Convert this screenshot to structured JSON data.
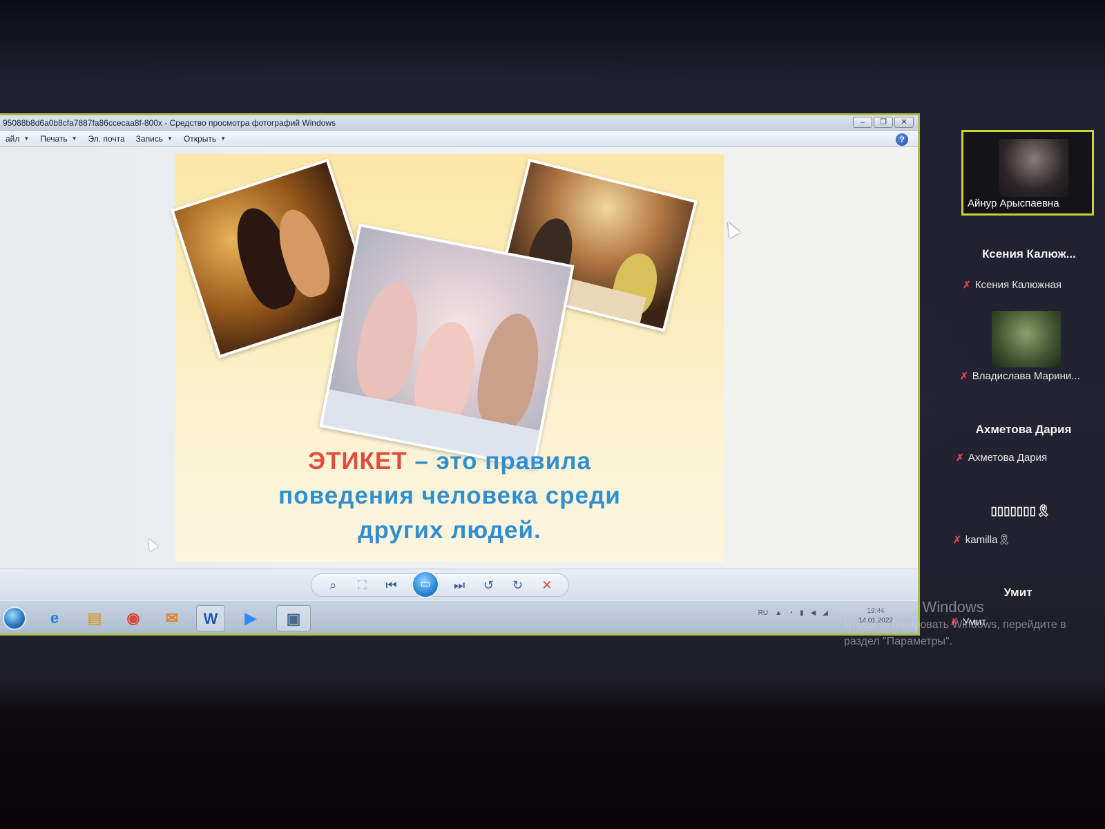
{
  "viewer": {
    "title": "95088b8d6a0b8cfa7887fa86ccecaa8f-800x - Средство просмотра фотографий Windows",
    "menu": [
      {
        "label": "айл"
      },
      {
        "label": "Печать"
      },
      {
        "label": "Эл. почта"
      },
      {
        "label": "Запись"
      },
      {
        "label": "Открыть"
      }
    ],
    "help_icon": "?",
    "window_buttons": {
      "minimize": "‒",
      "maximize": "❐",
      "close": "✕"
    }
  },
  "slide": {
    "term": "ЭТИКЕТ",
    "line1_rest": " – это правила",
    "line2": "поведения человека среди",
    "line3": "других людей.",
    "photos": [
      "ballroom-dance-photo",
      "family-cafe-photo",
      "girls-tea-party-photo"
    ]
  },
  "controls": {
    "zoom_icon": "⌕",
    "fit_icon": "⛶",
    "prev_icon": "⏮",
    "slideshow_icon": "▭",
    "next_icon": "⏭",
    "rotate_left_icon": "↺",
    "rotate_right_icon": "↻",
    "delete_icon": "✕"
  },
  "taskbar": {
    "icons": [
      "start-orb",
      "internet-explorer-icon",
      "folder-icon",
      "chrome-icon",
      "outlook-icon",
      "word-icon",
      "zoom-icon",
      "photo-viewer-icon"
    ],
    "word_label": "W",
    "lang": "RU",
    "time": "19:44",
    "date": "14.01.2022"
  },
  "participants": {
    "active": {
      "name": "Айнур Арыспаевна"
    },
    "list": [
      {
        "display": "Ксения Калюж...",
        "name": "Ксения Калюжная"
      },
      {
        "display": "",
        "name": "Владислава Марини..."
      },
      {
        "display": "Ахметова Дария",
        "name": "Ахметова Дария"
      },
      {
        "display": "▯▯▯▯▯▯▯🎗",
        "name": "kamilla🎗"
      },
      {
        "display": "Умит",
        "name": "Умит"
      }
    ]
  },
  "watermark": {
    "title": "Активация Windows",
    "line1": "Чтобы активировать Windows, перейдите в",
    "line2": "раздел \"Параметры\"."
  }
}
